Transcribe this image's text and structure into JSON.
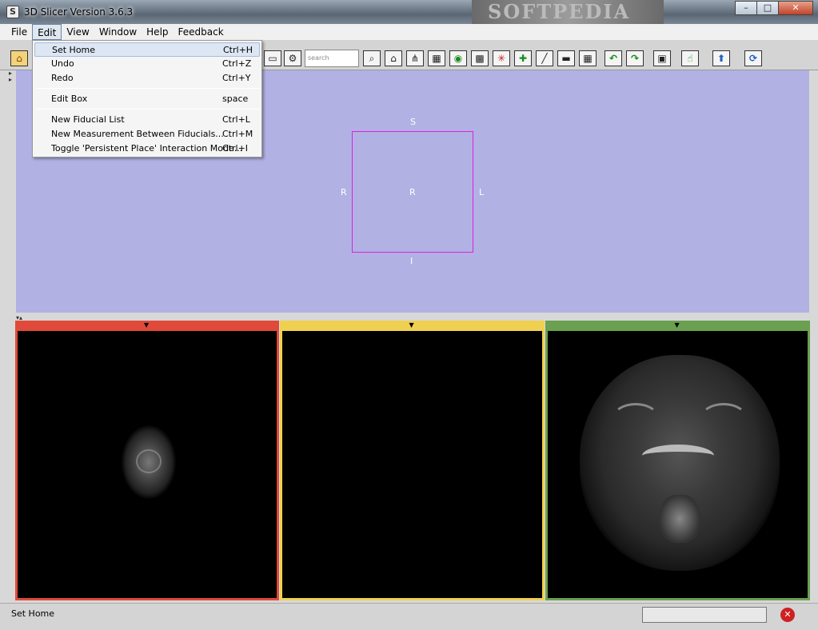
{
  "window": {
    "title": "3D Slicer Version 3.6.3",
    "watermark": "SOFTPEDIA",
    "min": "–",
    "max": "□",
    "close": "✕"
  },
  "menubar": [
    "File",
    "Edit",
    "View",
    "Window",
    "Help",
    "Feedback"
  ],
  "toolbar": {
    "search_placeholder": "search modules"
  },
  "edit_menu": {
    "set_home": {
      "label": "Set Home",
      "shortcut": "Ctrl+H"
    },
    "undo": {
      "label": "Undo",
      "shortcut": "Ctrl+Z"
    },
    "redo": {
      "label": "Redo",
      "shortcut": "Ctrl+Y"
    },
    "edit_box": {
      "label": "Edit Box",
      "shortcut": "space"
    },
    "new_fiducial": {
      "label": "New Fiducial List",
      "shortcut": "Ctrl+L"
    },
    "new_measurement": {
      "label": "New Measurement Between Fiducials...",
      "shortcut": "Ctrl+M"
    },
    "toggle_place": {
      "label": "Toggle 'Persistent Place' Interaction Mode...",
      "shortcut": "Ctrl+I"
    }
  },
  "view3d": {
    "superior": "S",
    "inferior": "I",
    "right": "R",
    "left": "L",
    "center": "R"
  },
  "slices": {
    "red_color": "#e04a3a",
    "yellow_color": "#f0d050",
    "green_color": "#6aa050"
  },
  "status": {
    "text": "Set Home"
  }
}
